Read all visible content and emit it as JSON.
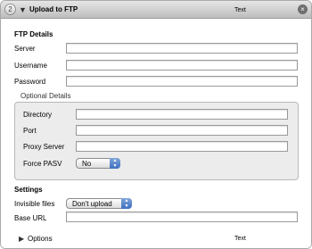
{
  "header": {
    "step_number": "2",
    "disclosure_glyph": "▼",
    "title": "Upload to FTP",
    "right_text": "Text",
    "close_glyph": "×"
  },
  "ftp_details": {
    "heading": "FTP Details",
    "server_label": "Server",
    "server_value": "",
    "username_label": "Username",
    "username_value": "",
    "password_label": "Password",
    "password_value": ""
  },
  "optional_details": {
    "heading": "Optional Details",
    "directory_label": "Directory",
    "directory_value": "",
    "port_label": "Port",
    "port_value": "",
    "proxy_label": "Proxy Server",
    "proxy_value": "",
    "force_pasv_label": "Force PASV",
    "force_pasv_value": "No"
  },
  "settings": {
    "heading": "Settings",
    "invisible_label": "Invisible files",
    "invisible_value": "Don't upload",
    "base_url_label": "Base URL",
    "base_url_value": ""
  },
  "footer": {
    "options_glyph": "▶",
    "options_label": "Options",
    "right_text": "Text"
  },
  "icons": {
    "step": "step-number-badge",
    "disclosure": "disclosure-triangle-down-icon",
    "close": "close-icon",
    "popup": "popup-arrows-icon",
    "options": "disclosure-triangle-right-icon"
  },
  "colors": {
    "header_top": "#e6e6e6",
    "header_bottom": "#bdbdbd",
    "group_background": "#ececec",
    "popup_accent": "#3d6fc0"
  }
}
